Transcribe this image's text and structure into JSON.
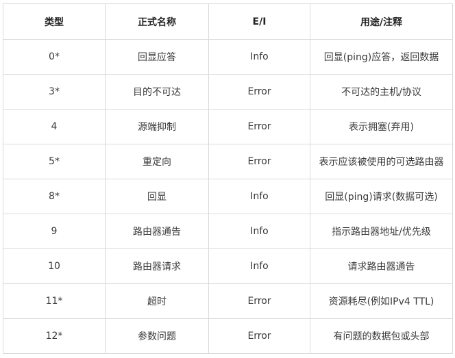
{
  "table": {
    "headers": [
      "类型",
      "正式名称",
      "E/I",
      "用途/注释"
    ],
    "rows": [
      [
        "0*",
        "回显应答",
        "Info",
        "回显(ping)应答，返回数据"
      ],
      [
        "3*",
        "目的不可达",
        "Error",
        "不可达的主机/协议"
      ],
      [
        "4",
        "源端抑制",
        "Error",
        "表示拥塞(弃用)"
      ],
      [
        "5*",
        "重定向",
        "Error",
        "表示应该被使用的可选路由器"
      ],
      [
        "8*",
        "回显",
        "Info",
        "回显(ping)请求(数据可选)"
      ],
      [
        "9",
        "路由器通告",
        "Info",
        "指示路由器地址/优先级"
      ],
      [
        "10",
        "路由器请求",
        "Info",
        "请求路由器通告"
      ],
      [
        "11*",
        "超时",
        "Error",
        "资源耗尽(例如IPv4 TTL)"
      ],
      [
        "12*",
        "参数问题",
        "Error",
        "有问题的数据包或头部"
      ]
    ]
  }
}
